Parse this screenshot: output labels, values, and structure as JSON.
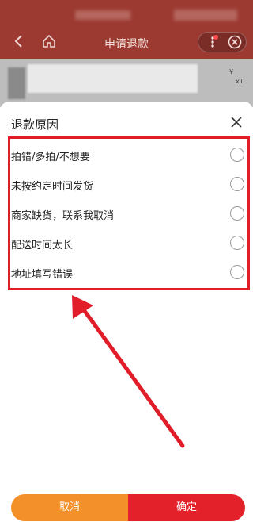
{
  "header": {
    "title": "申请退款"
  },
  "product": {
    "price_symbol": "¥",
    "quantity": "x1"
  },
  "sheet": {
    "title": "退款原因",
    "reasons": [
      {
        "label": "拍错/多拍/不想要"
      },
      {
        "label": "未按约定时间发货"
      },
      {
        "label": "商家缺货，联系我取消"
      },
      {
        "label": "配送时间太长"
      },
      {
        "label": "地址填写错误"
      }
    ]
  },
  "actions": {
    "cancel_label": "取消",
    "confirm_label": "确定"
  },
  "colors": {
    "header_bg": "#9c3a32",
    "highlight": "#e11d2a",
    "cancel_bg": "#f4902a",
    "confirm_bg": "#e3212b"
  }
}
